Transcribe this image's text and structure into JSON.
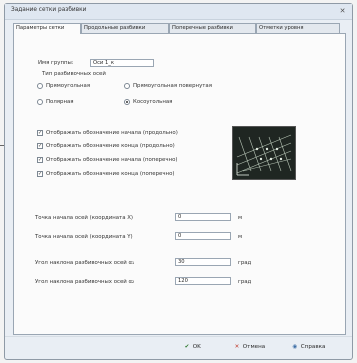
{
  "window": {
    "title": "Задание сетки разбивки",
    "close_glyph": "✕"
  },
  "tabs": [
    {
      "label": "Параметры сетки",
      "active": true
    },
    {
      "label": "Продольные разбивки",
      "active": false
    },
    {
      "label": "Поперечные разбивки",
      "active": false
    },
    {
      "label": "Отметки уровня",
      "active": false
    }
  ],
  "group_name": {
    "label": "Имя группы:",
    "value": "Оси 1_к"
  },
  "axes_type": {
    "label": "Тип разбивочных осей",
    "options": [
      {
        "label": "Прямоугольная",
        "selected": false
      },
      {
        "label": "Прямоугольная повернутая",
        "selected": false
      },
      {
        "label": "Полярная",
        "selected": false
      },
      {
        "label": "Косоугольная",
        "selected": true
      }
    ]
  },
  "checkboxes": [
    {
      "label": "Отображать обозначение начала (продольно)",
      "checked": true
    },
    {
      "label": "Отображать обозначение конца (продольно)",
      "checked": true
    },
    {
      "label": "Отображать обозначение начала (поперечно)",
      "checked": true
    },
    {
      "label": "Отображать обозначение конца (поперечно)",
      "checked": true
    }
  ],
  "origin_x": {
    "label": "Точка начала осей (координата X)",
    "value": "0",
    "unit": "м"
  },
  "origin_y": {
    "label": "Точка начала осей (координата Y)",
    "value": "0",
    "unit": "м"
  },
  "angle_1": {
    "label": "Угол наклона разбивочных осей α₁",
    "value": "30",
    "unit": "град"
  },
  "angle_2": {
    "label": "Угол наклона разбивочных осей α₂",
    "value": "120",
    "unit": "град"
  },
  "buttons": {
    "ok": {
      "label": "OK",
      "icon": "check-icon"
    },
    "cancel": {
      "label": "Отмена",
      "icon": "close-icon"
    },
    "help": {
      "label": "Справка",
      "icon": "help-icon"
    }
  },
  "colors": {
    "preview_bg": "#1f2622",
    "preview_lines": "#b9c7b8",
    "cancel_icon": "#c0392b",
    "ok_icon": "#2f7a2f"
  }
}
